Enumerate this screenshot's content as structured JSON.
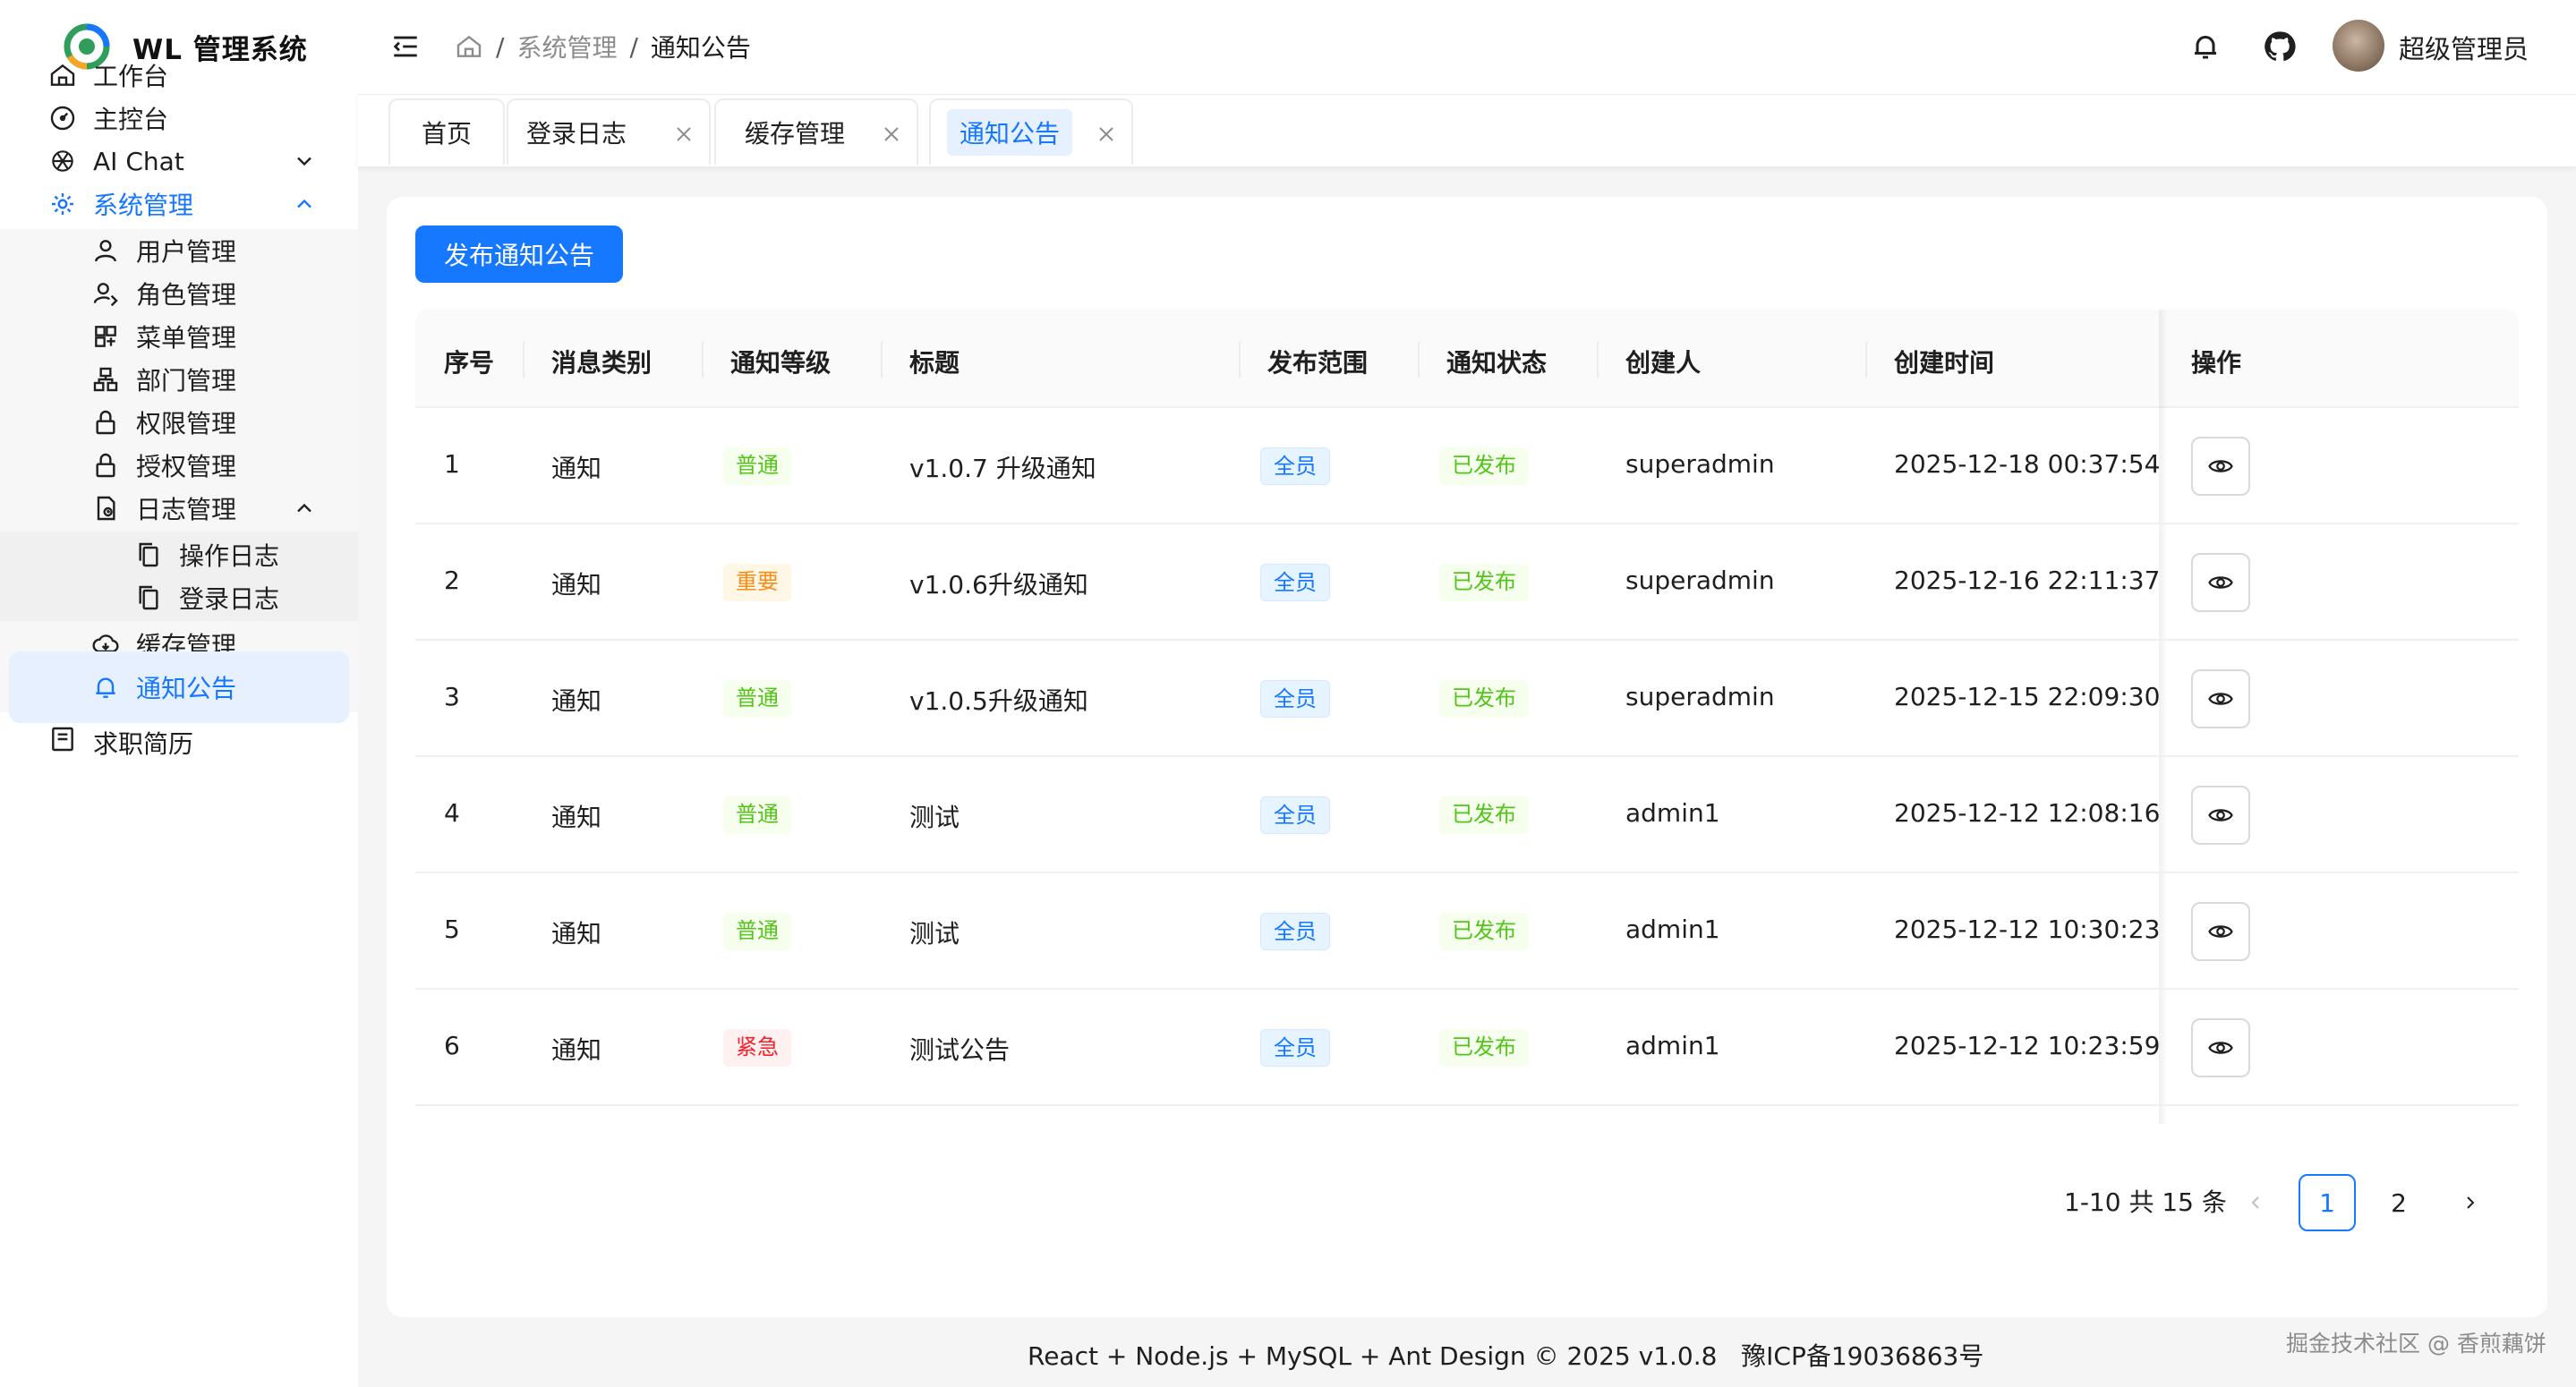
{
  "app": {
    "title": "WL 管理系统"
  },
  "colors": {
    "accent": "#1677ff",
    "success": "#52c41a",
    "warning": "#fa8c16",
    "danger": "#f5222d"
  },
  "sidebar": {
    "items": [
      {
        "label": "工作台",
        "icon": "home-icon"
      },
      {
        "label": "主控台",
        "icon": "dashboard-icon"
      },
      {
        "label": "AI Chat",
        "icon": "openai-icon"
      },
      {
        "label": "系统管理",
        "icon": "gear-icon"
      },
      {
        "label": "用户管理",
        "icon": "user-icon"
      },
      {
        "label": "角色管理",
        "icon": "role-icon"
      },
      {
        "label": "菜单管理",
        "icon": "menu-grid-icon"
      },
      {
        "label": "部门管理",
        "icon": "org-icon"
      },
      {
        "label": "权限管理",
        "icon": "lock-icon"
      },
      {
        "label": "授权管理",
        "icon": "lock-icon"
      },
      {
        "label": "日志管理",
        "icon": "log-icon"
      },
      {
        "label": "操作日志",
        "icon": "copy-icon"
      },
      {
        "label": "登录日志",
        "icon": "copy-icon"
      },
      {
        "label": "缓存管理",
        "icon": "cloud-icon"
      },
      {
        "label": "通知公告",
        "icon": "bell-icon"
      },
      {
        "label": "求职简历",
        "icon": "resume-icon"
      }
    ]
  },
  "header": {
    "breadcrumb": [
      "系统管理",
      "通知公告"
    ],
    "user_name": "超级管理员"
  },
  "tabs": [
    {
      "label": "首页",
      "closable": false
    },
    {
      "label": "登录日志",
      "closable": true
    },
    {
      "label": "缓存管理",
      "closable": true
    },
    {
      "label": "通知公告",
      "closable": true,
      "active": true
    }
  ],
  "toolbar": {
    "publish_label": "发布通知公告"
  },
  "table": {
    "columns": [
      "序号",
      "消息类别",
      "通知等级",
      "标题",
      "发布范围",
      "通知状态",
      "创建人",
      "创建时间",
      "操作"
    ],
    "rows": [
      {
        "no": "1",
        "type": "通知",
        "level": "普通",
        "title": "v1.0.7 升级通知",
        "scope": "全员",
        "status": "已发布",
        "creator": "superadmin",
        "time": "2025-12-18 00:37:54"
      },
      {
        "no": "2",
        "type": "通知",
        "level": "重要",
        "title": "v1.0.6升级通知",
        "scope": "全员",
        "status": "已发布",
        "creator": "superadmin",
        "time": "2025-12-16 22:11:37"
      },
      {
        "no": "3",
        "type": "通知",
        "level": "普通",
        "title": "v1.0.5升级通知",
        "scope": "全员",
        "status": "已发布",
        "creator": "superadmin",
        "time": "2025-12-15 22:09:30"
      },
      {
        "no": "4",
        "type": "通知",
        "level": "普通",
        "title": "测试",
        "scope": "全员",
        "status": "已发布",
        "creator": "admin1",
        "time": "2025-12-12 12:08:16"
      },
      {
        "no": "5",
        "type": "通知",
        "level": "普通",
        "title": "测试",
        "scope": "全员",
        "status": "已发布",
        "creator": "admin1",
        "time": "2025-12-12 10:30:23"
      },
      {
        "no": "6",
        "type": "通知",
        "level": "紧急",
        "title": "测试公告",
        "scope": "全员",
        "status": "已发布",
        "creator": "admin1",
        "time": "2025-12-12 10:23:59"
      }
    ]
  },
  "pagination": {
    "total_text": "1-10 共 15 条",
    "pages": [
      "1",
      "2"
    ],
    "current": "1"
  },
  "footer": {
    "text": "React + Node.js + MySQL + Ant Design © 2025 v1.0.8   豫ICP备19036863号"
  },
  "watermark": "掘金技术社区 @ 香煎藕饼"
}
